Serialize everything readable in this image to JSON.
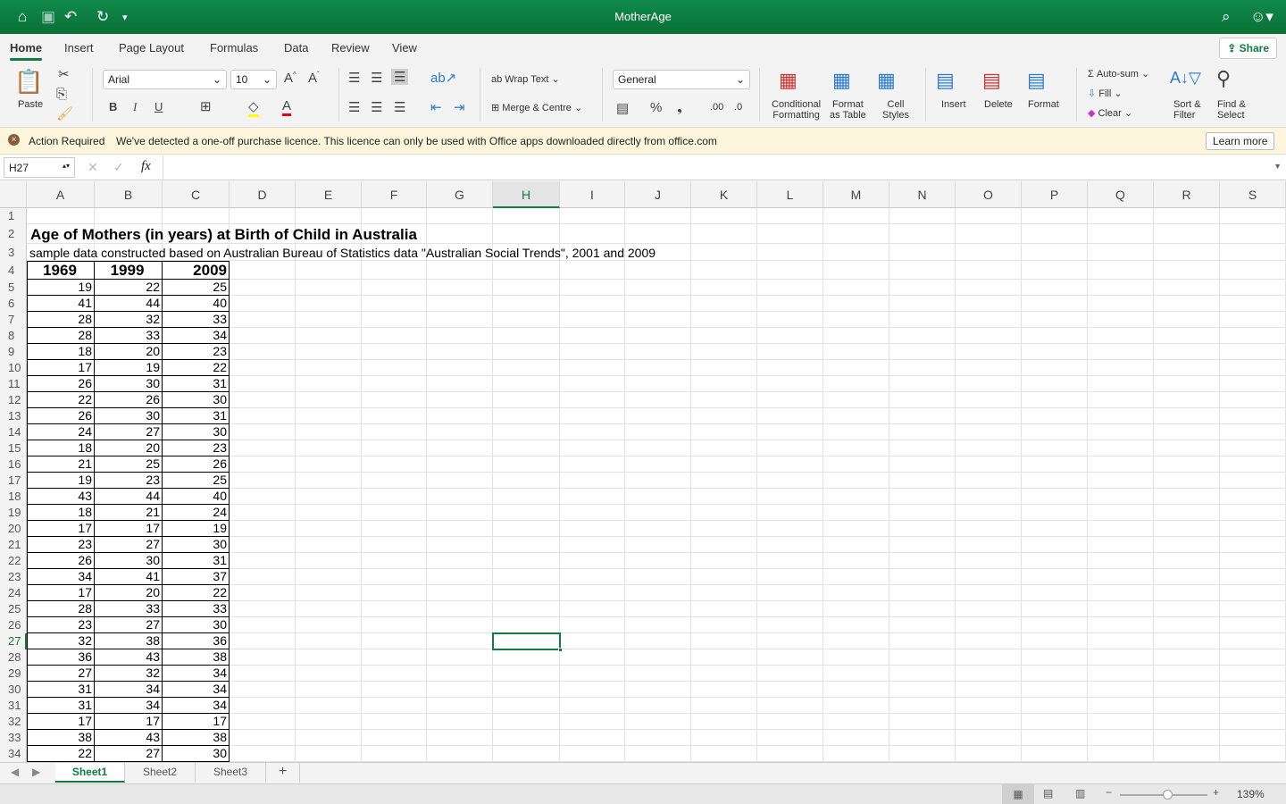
{
  "window": {
    "title": "MotherAge"
  },
  "ribbon_tabs": [
    "Home",
    "Insert",
    "Page Layout",
    "Formulas",
    "Data",
    "Review",
    "View"
  ],
  "share_label": "Share",
  "ribbon": {
    "paste": "Paste",
    "font": "Arial",
    "size": "10",
    "wrap_text": "Wrap Text",
    "merge": "Merge & Centre",
    "number_format": "General",
    "conditional": [
      "Conditional",
      "Formatting"
    ],
    "format_table": [
      "Format",
      "as Table"
    ],
    "cell_styles": [
      "Cell",
      "Styles"
    ],
    "insert": "Insert",
    "delete": "Delete",
    "format": "Format",
    "autosum": "Auto-sum",
    "fill": "Fill",
    "clear": "Clear",
    "sort": [
      "Sort &",
      "Filter"
    ],
    "find": [
      "Find &",
      "Select"
    ],
    "bold": "B",
    "italic": "I",
    "underline": "U"
  },
  "notice": {
    "title": "Action Required",
    "message": "We've detected a one-off purchase licence. This licence can only be used with Office apps downloaded directly from office.com",
    "button": "Learn more"
  },
  "formula_bar": {
    "name_box": "H27",
    "fx": "fx",
    "value": ""
  },
  "columns": [
    "A",
    "B",
    "C",
    "D",
    "E",
    "F",
    "G",
    "H",
    "I",
    "J",
    "K",
    "L",
    "M",
    "N",
    "O",
    "P",
    "Q",
    "R",
    "S"
  ],
  "selected_cell": "H27",
  "sheet": {
    "title": "Age of Mothers (in years) at Birth of Child in Australia",
    "subtitle": "sample data constructed based on Australian Bureau of Statistics data \"Australian Social Trends\", 2001 and 2009",
    "headers": [
      "1969",
      "1999",
      "2009"
    ],
    "rows": [
      [
        19,
        22,
        25
      ],
      [
        41,
        44,
        40
      ],
      [
        28,
        32,
        33
      ],
      [
        28,
        33,
        34
      ],
      [
        18,
        20,
        23
      ],
      [
        17,
        19,
        22
      ],
      [
        26,
        30,
        31
      ],
      [
        22,
        26,
        30
      ],
      [
        26,
        30,
        31
      ],
      [
        24,
        27,
        30
      ],
      [
        18,
        20,
        23
      ],
      [
        21,
        25,
        26
      ],
      [
        19,
        23,
        25
      ],
      [
        43,
        44,
        40
      ],
      [
        18,
        21,
        24
      ],
      [
        17,
        17,
        19
      ],
      [
        23,
        27,
        30
      ],
      [
        26,
        30,
        31
      ],
      [
        34,
        41,
        37
      ],
      [
        17,
        20,
        22
      ],
      [
        28,
        33,
        33
      ],
      [
        23,
        27,
        30
      ],
      [
        32,
        38,
        36
      ],
      [
        36,
        43,
        38
      ],
      [
        27,
        32,
        34
      ],
      [
        31,
        34,
        34
      ],
      [
        31,
        34,
        34
      ],
      [
        17,
        17,
        17
      ],
      [
        38,
        43,
        38
      ],
      [
        22,
        27,
        30
      ]
    ]
  },
  "sheet_tabs": [
    "Sheet1",
    "Sheet2",
    "Sheet3"
  ],
  "active_sheet": "Sheet1",
  "zoom": "139%",
  "colors": {
    "brand": "#107c41"
  }
}
